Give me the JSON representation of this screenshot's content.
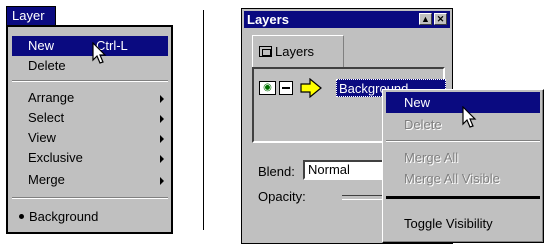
{
  "layer_menu": {
    "title": "Layer",
    "items": [
      {
        "label": "New",
        "shortcut": "Ctrl-L",
        "highlighted": true
      },
      {
        "label": "Delete"
      },
      {
        "label": "Arrange",
        "submenu": true
      },
      {
        "label": "Select",
        "submenu": true
      },
      {
        "label": "View",
        "submenu": true
      },
      {
        "label": "Exclusive",
        "submenu": true
      },
      {
        "label": "Merge",
        "submenu": true
      }
    ],
    "current_layer": "Background"
  },
  "palette": {
    "title": "Layers",
    "tab_label": "Layers",
    "layer_name": "Background",
    "blend_label": "Blend:",
    "blend_value": "Normal",
    "opacity_label": "Opacity:"
  },
  "context_menu": {
    "items": [
      {
        "label": "New",
        "highlighted": true
      },
      {
        "label": "Delete",
        "disabled": true
      },
      {
        "label": "Merge All",
        "disabled": true
      },
      {
        "label": "Merge All Visible",
        "disabled": true
      },
      {
        "label": "Toggle Visibility"
      }
    ]
  },
  "colors": {
    "highlight": "#0a0a80",
    "face": "#c0c0c0"
  }
}
